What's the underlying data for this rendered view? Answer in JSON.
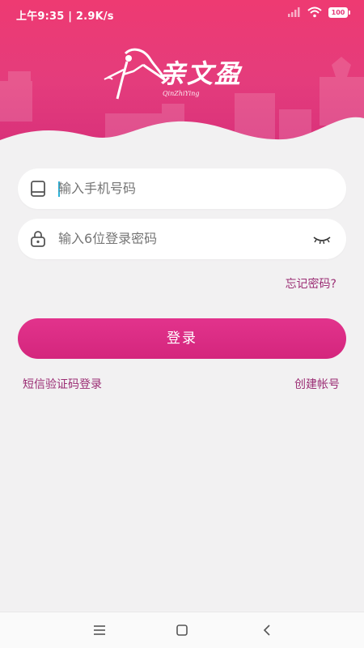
{
  "status_bar": {
    "time": "上午9:35 | 2.9K/s",
    "battery": "100"
  },
  "logo": {
    "title": "亲文盈",
    "subtitle": "QinZhiYing"
  },
  "form": {
    "phone_placeholder": "输入手机号码",
    "password_placeholder": "输入6位登录密码",
    "forgot_label": "忘记密码?",
    "login_label": "登录",
    "sms_login_label": "短信验证码登录",
    "register_label": "创建帐号"
  },
  "colors": {
    "header_top": "#ee3a72",
    "header_bottom": "#d8307a",
    "button": "#d8297f",
    "link": "#9b2d74",
    "background": "#f2f1f2"
  },
  "icons": {
    "phone_field": "tablet-icon",
    "password_field": "lock-icon",
    "password_toggle": "eye-closed-icon",
    "nav_menu": "menu-icon",
    "nav_home": "home-square-icon",
    "nav_back": "back-chevron-icon"
  }
}
